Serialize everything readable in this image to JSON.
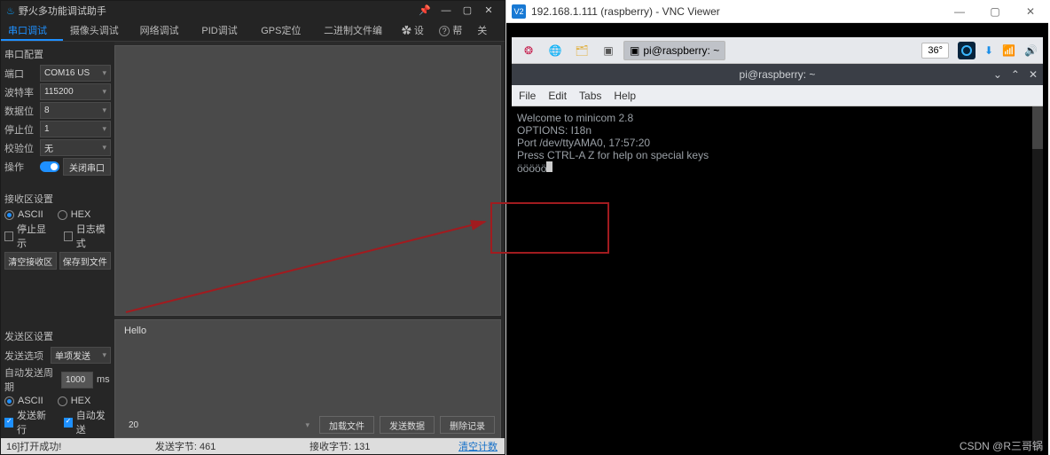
{
  "left": {
    "title": "野火多功能调试助手",
    "tabs": [
      "串口调试助手",
      "摄像头调试助手",
      "网络调试助手",
      "PID调试助手",
      "GPS定位功能",
      "二进制文件编辑器"
    ],
    "active_tab": 0,
    "topbar_buttons": {
      "settings": "设置",
      "help": "帮助",
      "about": "关于..."
    },
    "settings_icon": "✿",
    "help_icon": "?",
    "serial_config": {
      "heading": "串口配置",
      "port": {
        "label": "端口",
        "value": "COM16 US"
      },
      "baud": {
        "label": "波特率",
        "value": "115200"
      },
      "data": {
        "label": "数据位",
        "value": "8"
      },
      "stop": {
        "label": "停止位",
        "value": "1"
      },
      "parity": {
        "label": "校验位",
        "value": "无"
      },
      "op_label": "操作",
      "close_btn": "关闭串口"
    },
    "recv_config": {
      "heading": "接收区设置",
      "ascii": "ASCII",
      "hex": "HEX",
      "pause": "停止显示",
      "log": "日志模式",
      "clear": "清空接收区",
      "save": "保存到文件"
    },
    "send_config": {
      "heading": "发送区设置",
      "opt_label": "发送选项",
      "opt_value": "单项发送",
      "period_label": "自动发送周期",
      "period_value": "1000",
      "period_unit": "ms",
      "ascii": "ASCII",
      "hex": "HEX",
      "newline": "发送新行",
      "auto": "自动发送"
    },
    "send_text": "Hello",
    "send_bottom": {
      "left_value": "20",
      "load": "加载文件",
      "send": "发送数据",
      "del": "删除记录"
    },
    "status": {
      "left": "16]打开成功!",
      "sent": "发送字节: 461",
      "recv": "接收字节: 131",
      "clear": "清空计数"
    }
  },
  "right": {
    "title": "192.168.1.111 (raspberry) - VNC Viewer",
    "vnc_logo": "V2",
    "taskbar": {
      "widgets": [
        {
          "label": "pi@raspberry: ~",
          "active": true
        }
      ],
      "temp": "36°"
    },
    "term": {
      "title": "pi@raspberry: ~",
      "menus": [
        "File",
        "Edit",
        "Tabs",
        "Help"
      ],
      "lines": [
        "Welcome to minicom 2.8",
        "",
        "OPTIONS: I18n",
        "Port /dev/ttyAMA0, 17:57:20",
        "",
        "Press CTRL-A Z for help on special keys",
        "",
        "ööööö"
      ]
    }
  },
  "watermark": "CSDN @R三哥锅"
}
